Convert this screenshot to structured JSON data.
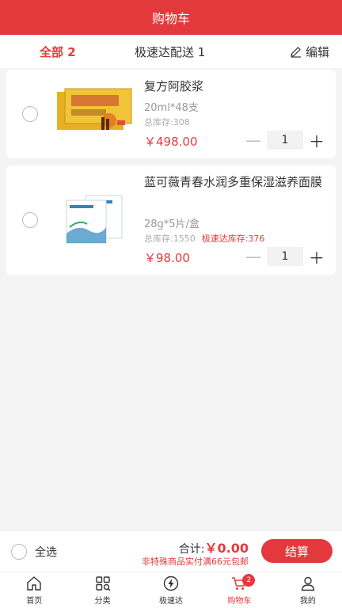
{
  "header": {
    "title": "购物车"
  },
  "tabs": {
    "all": "全部 2",
    "fast": "极速达配送 1",
    "edit": "编辑"
  },
  "items": [
    {
      "name": "复方阿胶浆",
      "spec": "20ml*48支",
      "stock": "总库存:308",
      "fast_stock": "",
      "price": "￥498.00",
      "qty": "1"
    },
    {
      "name": "蓝可薇青春水润多重保湿滋养面膜",
      "spec": "28g*5片/盒",
      "stock": "总库存:1550",
      "fast_stock": "极速达库存:376",
      "price": "￥98.00",
      "qty": "1"
    }
  ],
  "footer": {
    "select_all": "全选",
    "total_label": "合计:",
    "total_amount": "￥0.00",
    "shipping_note": "非特殊商品实付满66元包邮",
    "checkout": "结算"
  },
  "tabbar": {
    "home": "首页",
    "category": "分类",
    "fast": "极速达",
    "cart": "购物车",
    "cart_badge": "2",
    "mine": "我的"
  },
  "colors": {
    "accent": "#e4393c"
  }
}
